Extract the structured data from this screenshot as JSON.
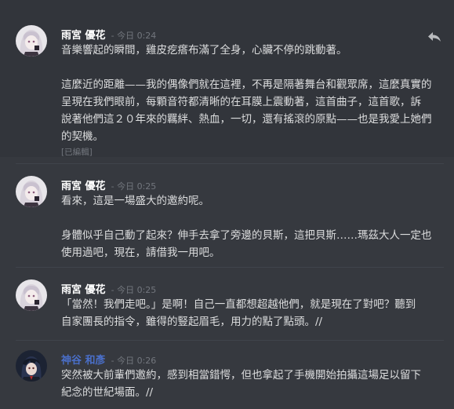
{
  "messages": [
    {
      "author": "雨宮 優花",
      "timestamp": "- 今日 0:24",
      "lines": [
        "音樂響起的瞬間，雞皮疙瘩布滿了全身，心臟不停的跳動著。",
        "",
        "這麼近的距離——我的偶像們就在這裡，不再是隔著舞台和觀眾席，這麼真實的",
        "呈現在我們眼前，每顆音符都清晰的在耳膜上震動著，這首曲子，這首歌，訴",
        "說著他們這２０年來的羈絆、熱血，一切，還有搖滾的原點——也是我愛上她們",
        "的契機。"
      ],
      "edited": "[已編輯]"
    },
    {
      "author": "雨宮 優花",
      "timestamp": "- 今日 0:25",
      "lines": [
        "看來，這是一場盛大的邀約呢。",
        "",
        "身體似乎自己動了起來？伸手去拿了旁邊的貝斯，這把貝斯……瑪茲大人一定也",
        "使用過吧，現在，請借我一用吧。"
      ]
    },
    {
      "author": "雨宮 優花",
      "timestamp": "- 今日 0:25",
      "lines": [
        "「當然！我們走吧。」是啊！自己一直都想超越他們，就是現在了對吧？聽到",
        "自家團長的指令，雖得的豎起眉毛，用力的點了點頭。//"
      ]
    },
    {
      "author": "神谷 和彥",
      "timestamp": "- 今日 0:26",
      "lines": [
        "突然被大前輩們邀約，感到相當錯愕，但也拿起了手機開始拍攝這場足以留下",
        "紀念的世紀場面。//"
      ]
    }
  ],
  "colors": {
    "background": "#36393f",
    "hover": "#32353b",
    "author_default": "#ffffff",
    "author_blue": "#4a6fc9",
    "timestamp": "#72767d"
  },
  "icons": {
    "reply": "reply-arrow-icon"
  }
}
